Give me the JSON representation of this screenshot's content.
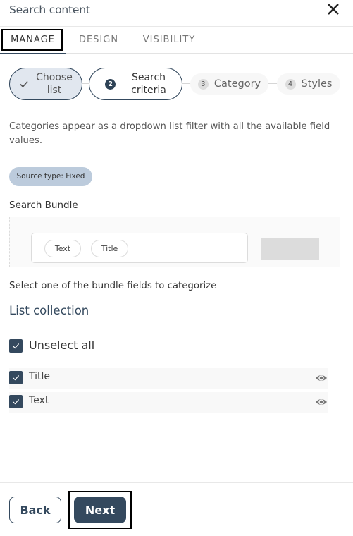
{
  "header": {
    "title": "Search content",
    "close_icon": "close-icon"
  },
  "tabs": [
    {
      "label": "MANAGE",
      "active": true
    },
    {
      "label": "DESIGN",
      "active": false
    },
    {
      "label": "VISIBILITY",
      "active": false
    }
  ],
  "stepper": {
    "steps": [
      {
        "number": "",
        "label_line1": "Choose",
        "label_line2": "list",
        "status": "completed",
        "icon": "check-icon"
      },
      {
        "number": "2",
        "label_line1": "Search",
        "label_line2": "criteria",
        "status": "current"
      },
      {
        "number": "3",
        "label": "Category",
        "status": "pending"
      },
      {
        "number": "4",
        "label": "Styles",
        "status": "pending"
      }
    ]
  },
  "description": "Categories appear as a dropdown list filter with all the available field values.",
  "source_badge": "Source type: Fixed",
  "search_bundle": {
    "label": "Search Bundle",
    "chips": [
      "Text",
      "Title"
    ]
  },
  "instruction": "Select one of the bundle fields to categorize",
  "list_collection": {
    "title": "List collection",
    "unselect_all": {
      "label": "Unselect all",
      "checked": true
    },
    "fields": [
      {
        "label": "Title",
        "checked": true,
        "icon": "eye-icon"
      },
      {
        "label": "Text",
        "checked": true,
        "icon": "eye-icon"
      }
    ]
  },
  "footer": {
    "back_label": "Back",
    "next_label": "Next"
  },
  "colors": {
    "primary": "#34495e",
    "badge_bg": "#bccbdc",
    "step_completed_bg": "#e1e7ef"
  }
}
